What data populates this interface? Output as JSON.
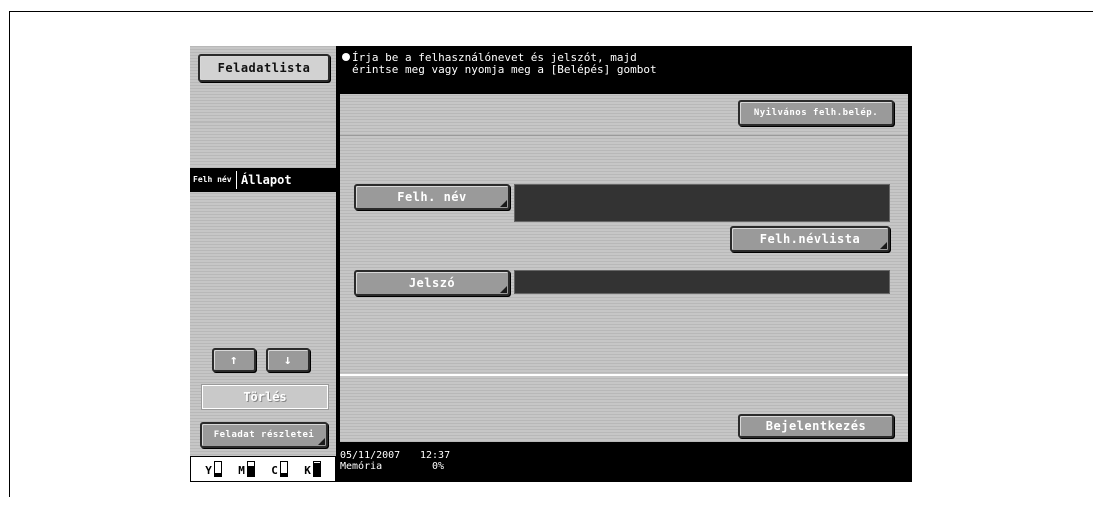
{
  "left_panel": {
    "task_list_label": "Feladatlista",
    "column_user": "Felh név",
    "column_status": "Állapot",
    "up_arrow": "↑",
    "down_arrow": "↓",
    "delete_label": "Törlés",
    "details_label": "Feladat részletei"
  },
  "toner": [
    {
      "label": "Y",
      "level": 0.25
    },
    {
      "label": "M",
      "level": 0.75
    },
    {
      "label": "C",
      "level": 0.25
    },
    {
      "label": "K",
      "level": 0.9
    }
  ],
  "message": {
    "line1": "Írja be a felhasználónevet és jelszót, majd",
    "line2": "érintse meg vagy nyomja meg a [Belépés] gombot"
  },
  "main": {
    "public_login_label": "Nyilvános felh.belép.",
    "username_label": "Felh. név",
    "username_value": "",
    "userlist_label": "Felh.névlista",
    "password_label": "Jelszó",
    "password_value": "",
    "login_label": "Bejelentkezés"
  },
  "status": {
    "date": "05/11/2007",
    "time": "12:37",
    "memory_label": "Memória",
    "memory_value": "0%"
  }
}
